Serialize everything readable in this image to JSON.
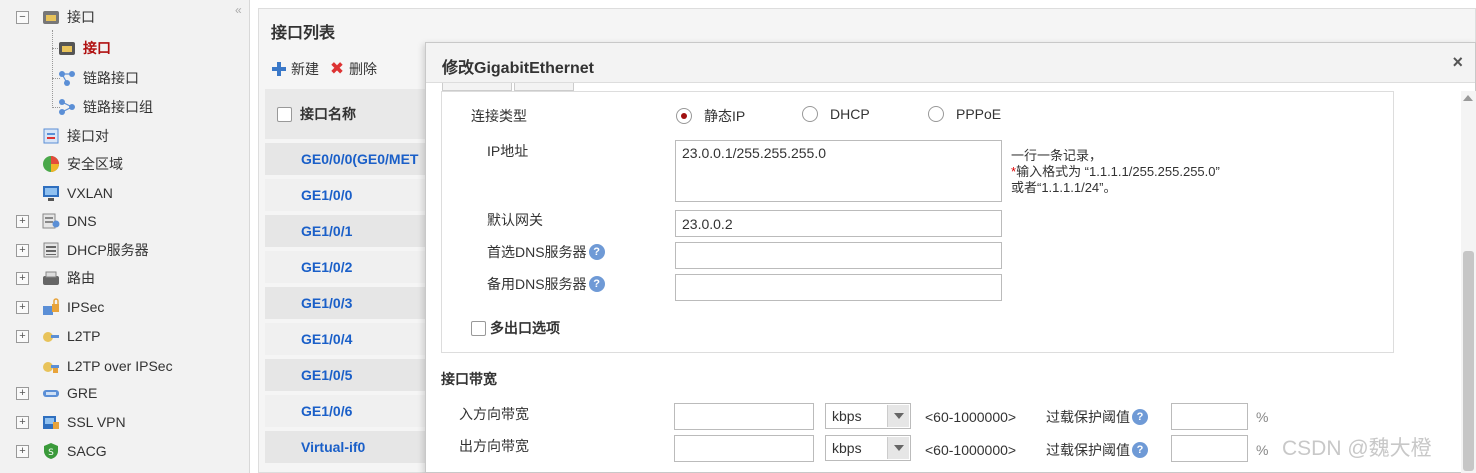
{
  "sidebar": {
    "collapse_glyph": "«",
    "items": [
      {
        "label": "接口",
        "icon": "interface-folder-icon"
      },
      {
        "label": "接口",
        "icon": "interface-icon"
      },
      {
        "label": "链路接口",
        "icon": "link-interface-icon"
      },
      {
        "label": "链路接口组",
        "icon": "link-interface-group-icon"
      },
      {
        "label": "接口对",
        "icon": "interface-pair-icon"
      },
      {
        "label": "安全区域",
        "icon": "security-zone-icon"
      },
      {
        "label": "VXLAN",
        "icon": "vxlan-icon"
      },
      {
        "label": "DNS",
        "icon": "dns-icon"
      },
      {
        "label": "DHCP服务器",
        "icon": "dhcp-server-icon"
      },
      {
        "label": "路由",
        "icon": "route-icon"
      },
      {
        "label": "IPSec",
        "icon": "ipsec-icon"
      },
      {
        "label": "L2TP",
        "icon": "l2tp-icon"
      },
      {
        "label": "L2TP over IPSec",
        "icon": "l2tp-over-ipsec-icon"
      },
      {
        "label": "GRE",
        "icon": "gre-icon"
      },
      {
        "label": "SSL VPN",
        "icon": "ssl-vpn-icon"
      },
      {
        "label": "SACG",
        "icon": "sacg-icon"
      }
    ]
  },
  "main": {
    "title": "接口列表",
    "new_label": "新建",
    "delete_label": "删除",
    "column_header": "接口名称",
    "rows": [
      "GE0/0/0(GE0/MET",
      "GE1/0/0",
      "GE1/0/1",
      "GE1/0/2",
      "GE1/0/3",
      "GE1/0/4",
      "GE1/0/5",
      "GE1/0/6",
      "Virtual-if0"
    ]
  },
  "modal": {
    "title": "修改GigabitEthernet",
    "close_glyph": "×",
    "connection_type_label": "连接类型",
    "radio_static": "静态IP",
    "radio_dhcp": "DHCP",
    "radio_pppoe": "PPPoE",
    "ip_label": "IP地址",
    "ip_value": "23.0.0.1/255.255.255.0",
    "hint_line1": "一行一条记录，",
    "hint_req": "*",
    "hint_line2": "输入格式为 “1.1.1.1/255.255.255.0”",
    "hint_line3": " 或者“1.1.1.1/24”。",
    "gateway_label": "默认网关",
    "gateway_value": "23.0.0.2",
    "dns1_label": "首选DNS服务器",
    "dns2_label": "备用DNS服务器",
    "help_glyph": "?",
    "multi_exit_label": "多出口选项",
    "bandwidth_title": "接口带宽",
    "inbound_label": "入方向带宽",
    "outbound_label": "出方向带宽",
    "unit": "kbps",
    "range": "<60-1000000>",
    "overload_label": "过载保护阈值",
    "percent": "%"
  },
  "watermark": "CSDN @魏大橙",
  "colors": {
    "accent": "#1a5fc8",
    "active": "#b01010",
    "radio_on": "#a01010"
  }
}
